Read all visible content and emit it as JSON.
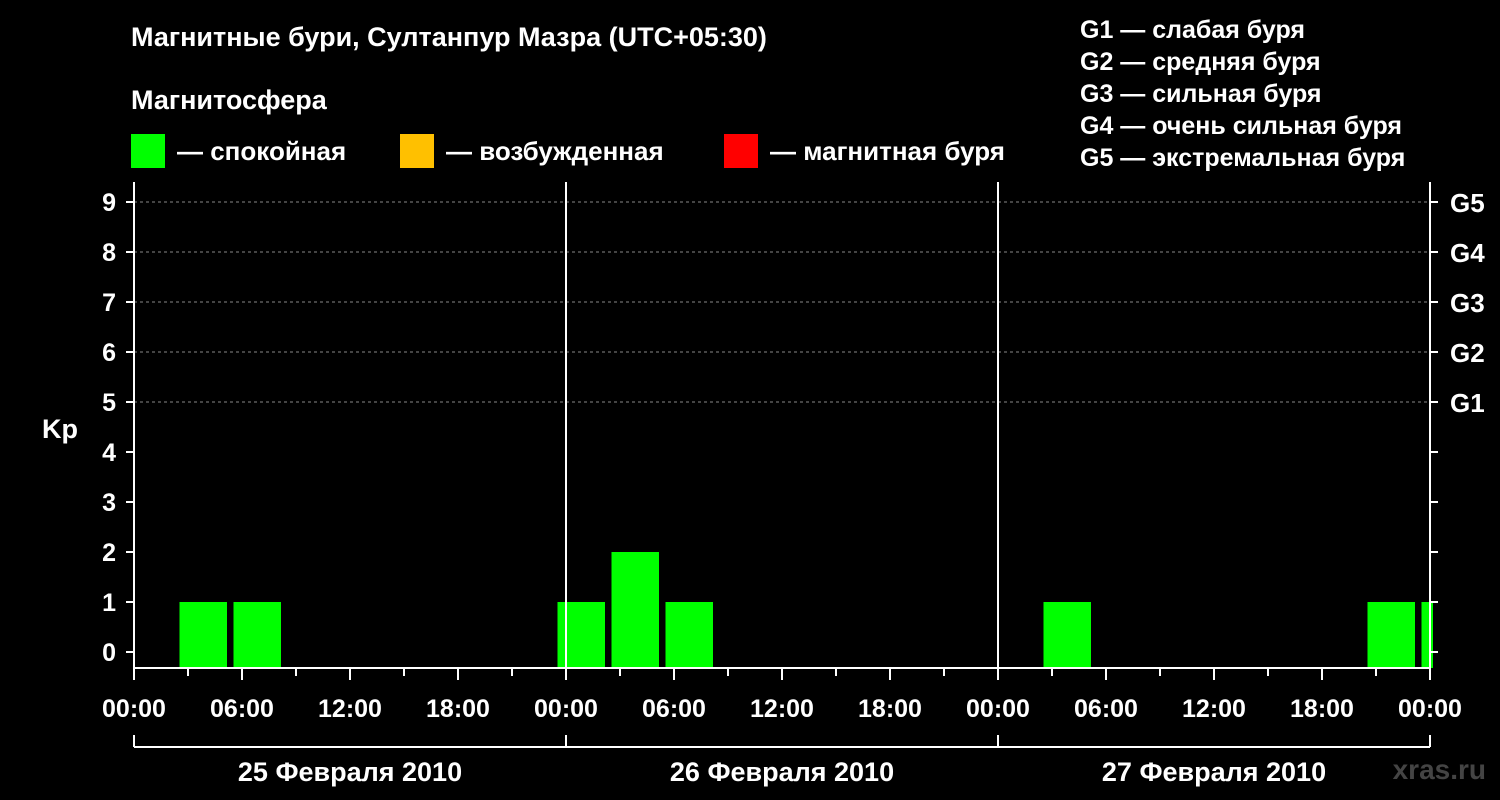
{
  "title": "Магнитные бури, Султанпур Мазра (UTC+05:30)",
  "magnetosphere_label": "Магнитосфера",
  "legend": [
    {
      "label": "— спокойная",
      "color": "#00ff00"
    },
    {
      "label": "— возбужденная",
      "color": "#ffc000"
    },
    {
      "label": "— магнитная буря",
      "color": "#ff0000"
    }
  ],
  "g_scale": [
    "G1 — слабая буря",
    "G2 — средняя буря",
    "G3 — сильная буря",
    "G4 — очень сильная буря",
    "G5 — экстремальная буря"
  ],
  "watermark": "xras.ru",
  "chart_data": {
    "type": "bar",
    "ylabel": "Kp",
    "ylim": [
      0,
      9
    ],
    "y_ticks": [
      "0",
      "1",
      "2",
      "3",
      "4",
      "5",
      "6",
      "7",
      "8",
      "9"
    ],
    "right_axis_labels": [
      {
        "kp": 5,
        "label": "G1"
      },
      {
        "kp": 6,
        "label": "G2"
      },
      {
        "kp": 7,
        "label": "G3"
      },
      {
        "kp": 8,
        "label": "G4"
      },
      {
        "kp": 9,
        "label": "G5"
      }
    ],
    "x_tick_labels": [
      "00:00",
      "06:00",
      "12:00",
      "18:00",
      "00:00",
      "06:00",
      "12:00",
      "18:00",
      "00:00",
      "06:00",
      "12:00",
      "18:00",
      "00:00"
    ],
    "days": [
      "25 Февраля 2010",
      "26 Февраля 2010",
      "27 Февраля 2010"
    ],
    "grid": true,
    "series": [
      {
        "values": [
          {
            "start": "2010-02-25 02:30",
            "end": "2010-02-25 05:30",
            "kp": 1
          },
          {
            "start": "2010-02-25 05:30",
            "end": "2010-02-25 08:30",
            "kp": 1
          },
          {
            "start": "2010-02-25 23:30",
            "end": "2010-02-26 02:30",
            "kp": 1
          },
          {
            "start": "2010-02-26 02:30",
            "end": "2010-02-26 05:30",
            "kp": 2
          },
          {
            "start": "2010-02-26 05:30",
            "end": "2010-02-26 08:30",
            "kp": 1
          },
          {
            "start": "2010-02-27 02:30",
            "end": "2010-02-27 05:30",
            "kp": 1
          },
          {
            "start": "2010-02-27 20:30",
            "end": "2010-02-27 23:30",
            "kp": 1
          },
          {
            "start": "2010-02-27 23:30",
            "end": "2010-02-28 00:30",
            "kp": 1
          }
        ]
      }
    ]
  }
}
